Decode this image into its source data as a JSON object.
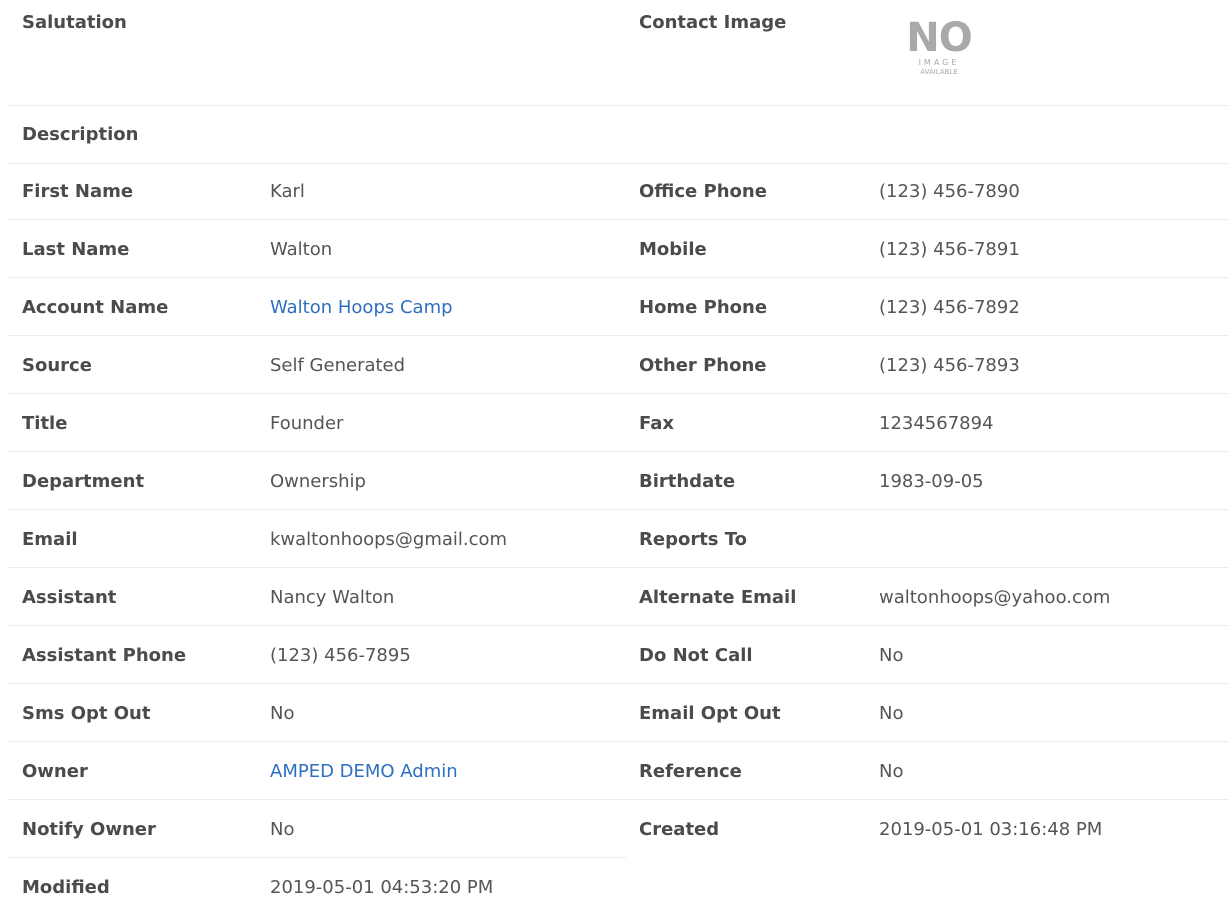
{
  "header": {
    "salutation_label": "Salutation",
    "contact_image_label": "Contact Image",
    "no_image": {
      "big": "NO",
      "line1": "IMAGE",
      "line2": "AVAILABLE"
    }
  },
  "description_label": "Description",
  "left_fields": [
    {
      "label": "First Name",
      "value": "Karl"
    },
    {
      "label": "Last Name",
      "value": "Walton"
    },
    {
      "label": "Account Name",
      "value": "Walton Hoops Camp"
    },
    {
      "label": "Source",
      "value": "Self Generated"
    },
    {
      "label": "Title",
      "value": "Founder"
    },
    {
      "label": "Department",
      "value": "Ownership"
    },
    {
      "label": "Email",
      "value": "kwaltonhoops@gmail.com"
    },
    {
      "label": "Assistant",
      "value": "Nancy Walton"
    },
    {
      "label": "Assistant Phone",
      "value": "(123) 456-7895"
    },
    {
      "label": "Sms Opt Out",
      "value": "No"
    },
    {
      "label": "Owner",
      "value": "AMPED DEMO Admin"
    },
    {
      "label": "Notify Owner",
      "value": "No"
    },
    {
      "label": "Modified",
      "value": "2019-05-01 04:53:20 PM"
    }
  ],
  "right_fields": [
    {
      "label": "Office Phone",
      "value": "(123) 456-7890"
    },
    {
      "label": "Mobile",
      "value": "(123) 456-7891"
    },
    {
      "label": "Home Phone",
      "value": "(123) 456-7892"
    },
    {
      "label": "Other Phone",
      "value": "(123) 456-7893"
    },
    {
      "label": "Fax",
      "value": "1234567894"
    },
    {
      "label": "Birthdate",
      "value": "1983-09-05"
    },
    {
      "label": "Reports To",
      "value": ""
    },
    {
      "label": "Alternate Email",
      "value": "waltonhoops@yahoo.com"
    },
    {
      "label": "Do Not Call",
      "value": "No"
    },
    {
      "label": "Email Opt Out",
      "value": "No"
    },
    {
      "label": "Reference",
      "value": "No"
    },
    {
      "label": "Created",
      "value": "2019-05-01 03:16:48 PM"
    }
  ],
  "colors": {
    "link": "#2f6fbf",
    "label": "#4b4b4b",
    "value": "#555555",
    "divider": "#ececec"
  }
}
